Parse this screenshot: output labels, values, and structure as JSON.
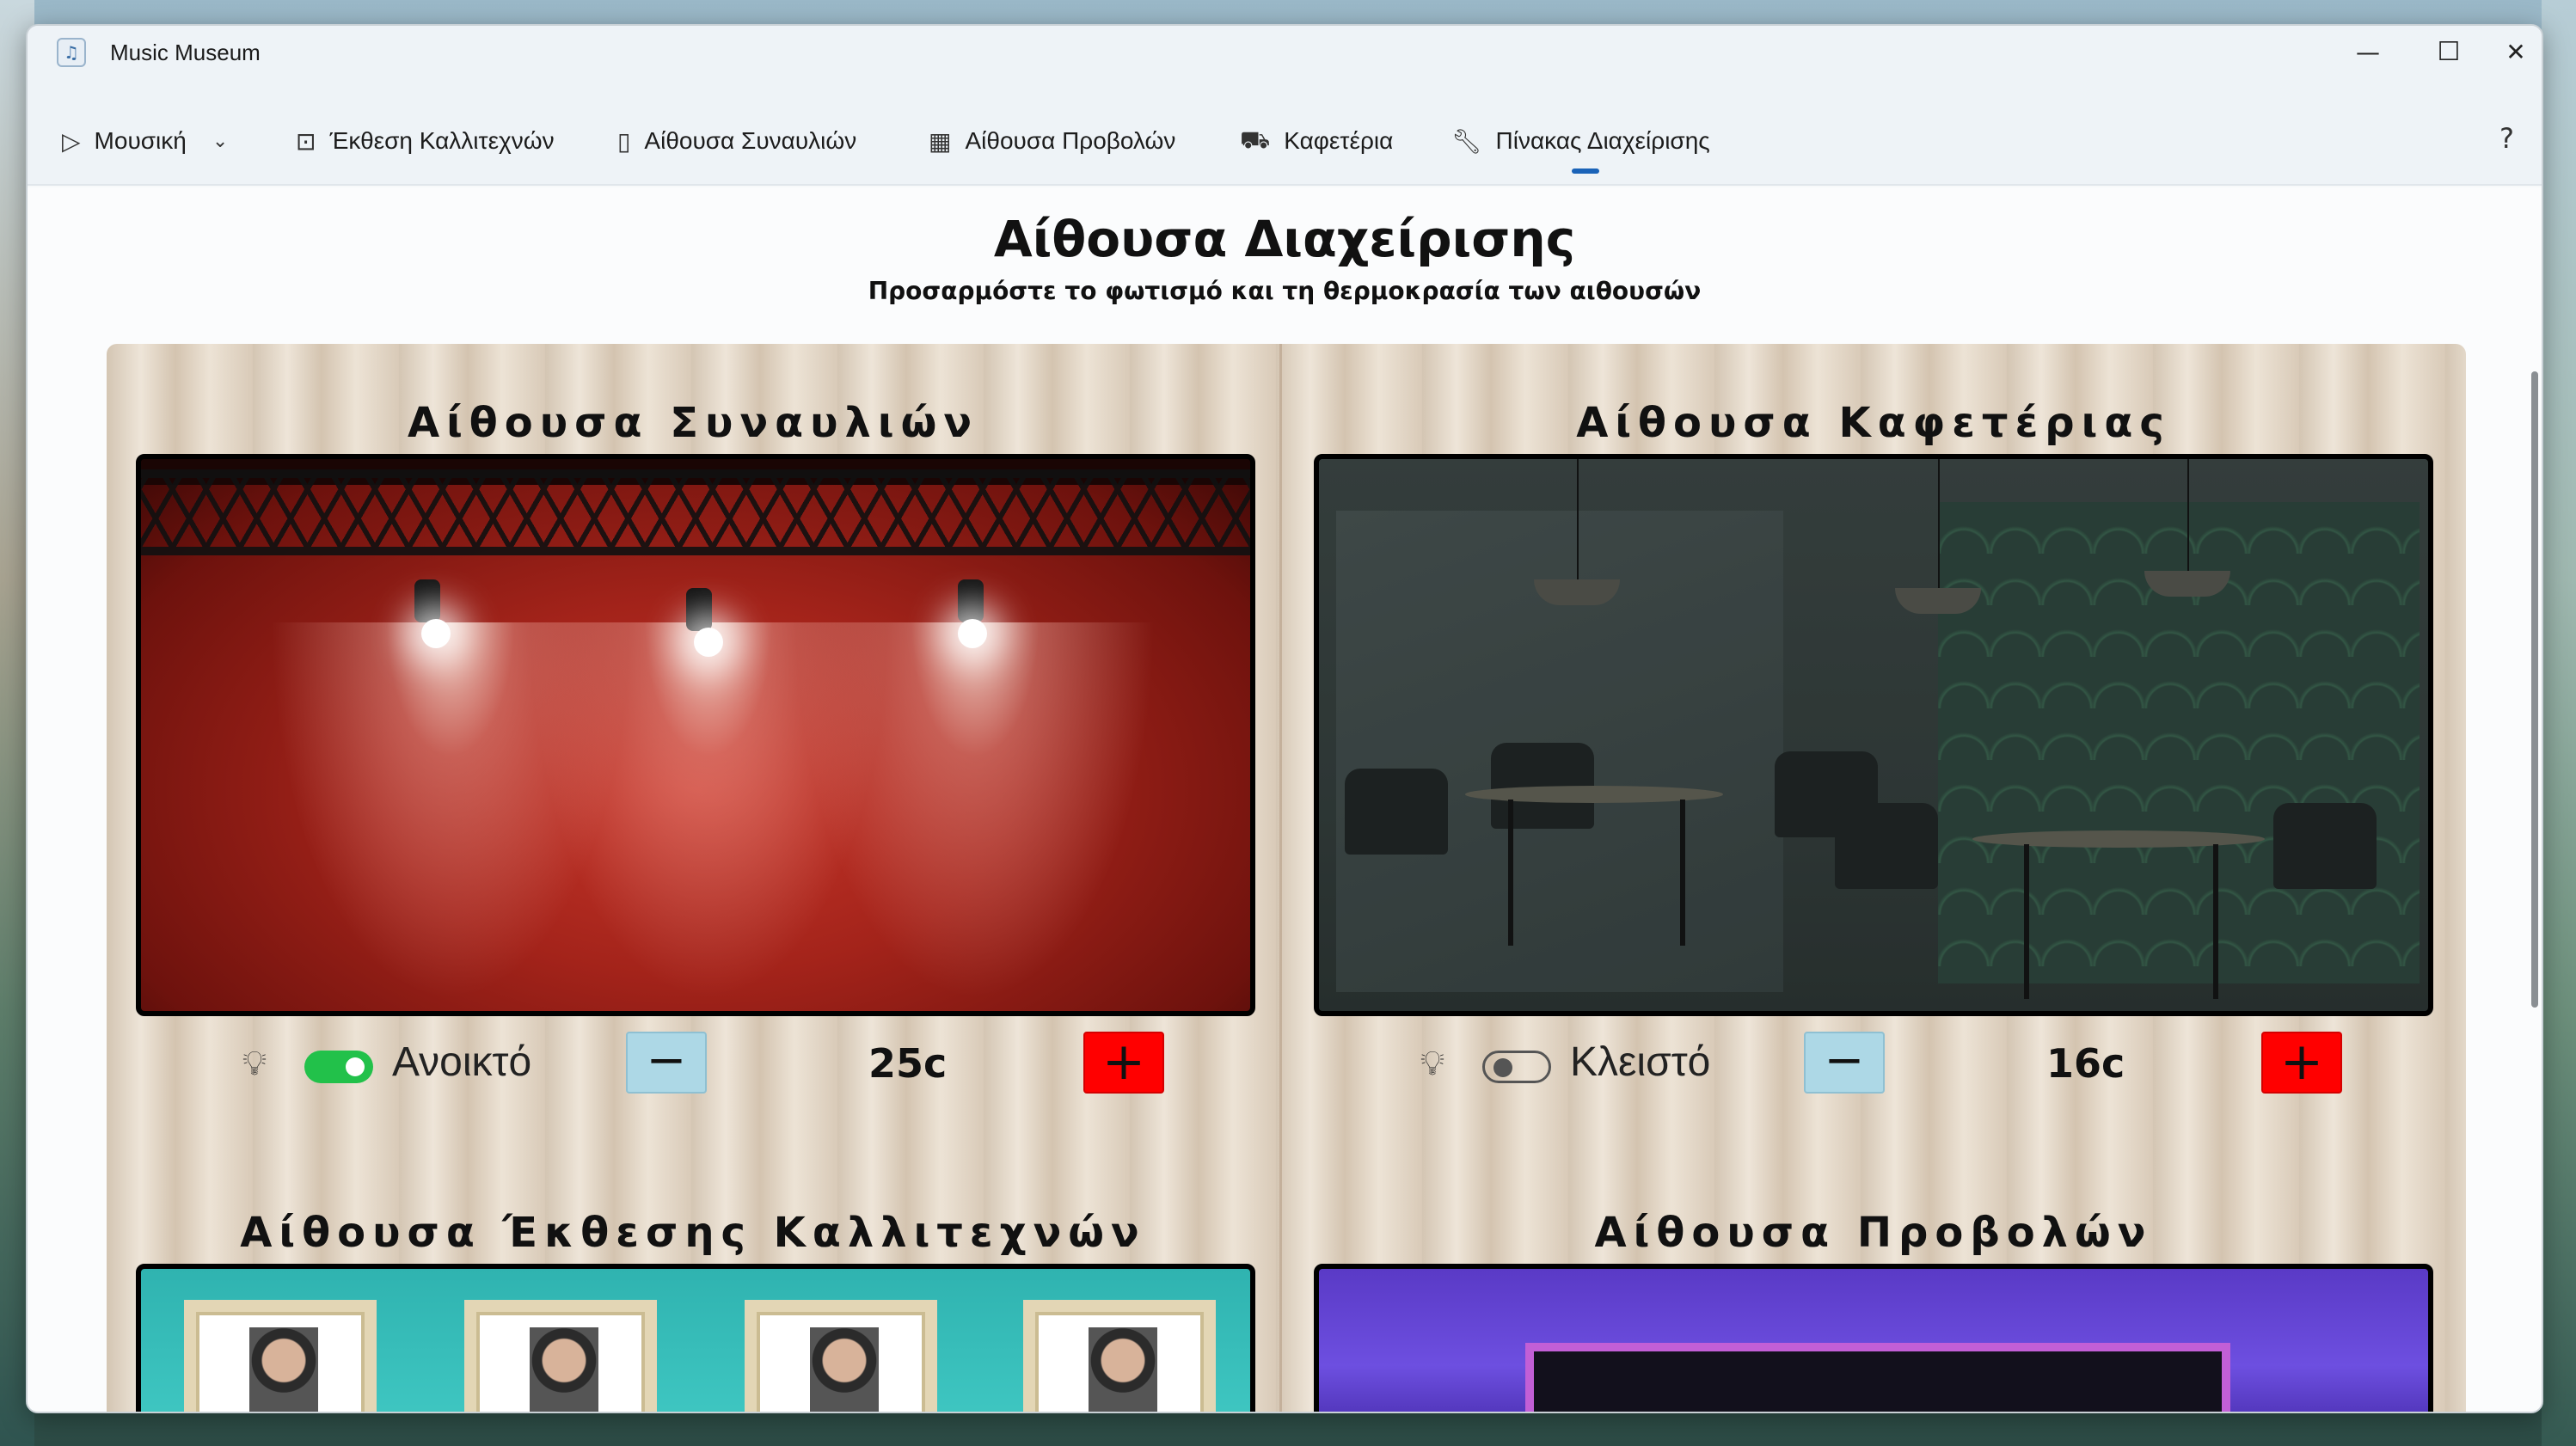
{
  "window": {
    "title": "Music Museum",
    "controls": {
      "minimize": "—",
      "maximize": "☐",
      "close": "✕"
    }
  },
  "nav": {
    "items": [
      {
        "label": "Μουσική",
        "icon": "play-icon",
        "has_dropdown": true
      },
      {
        "label": "Έκθεση Καλλιτεχνών",
        "icon": "photo-icon"
      },
      {
        "label": "Αίθουσα Συναυλιών",
        "icon": "device-icon"
      },
      {
        "label": "Αίθουσα Προβολών",
        "icon": "gallery-icon"
      },
      {
        "label": "Καφετέρια",
        "icon": "cart-icon"
      },
      {
        "label": "Πίνακας Διαχείρισης",
        "icon": "wrench-icon",
        "selected": true
      }
    ],
    "help": "?"
  },
  "page": {
    "title": "Αίθουσα Διαχείρισης",
    "subtitle": "Προσαρμόστε το φωτισμό και τη θερμοκρασία των αιθουσών"
  },
  "rooms": [
    {
      "name": "Αίθουσα Συναυλιών",
      "light_on": true,
      "light_state": "Ανοικτό",
      "minus": "−",
      "temperature": "25c",
      "plus": "+"
    },
    {
      "name": "Αίθουσα Καφετέριας",
      "light_on": false,
      "light_state": "Κλειστό",
      "minus": "−",
      "temperature": "16c",
      "plus": "+"
    },
    {
      "name": "Αίθουσα Έκθεσης Καλλιτεχνών"
    },
    {
      "name": "Αίθουσα Προβολών"
    }
  ],
  "colors": {
    "accent": "#1a63b8",
    "toggle_on": "#22c14a",
    "minus_button": "#add8e6",
    "plus_button": "#ff0000"
  }
}
